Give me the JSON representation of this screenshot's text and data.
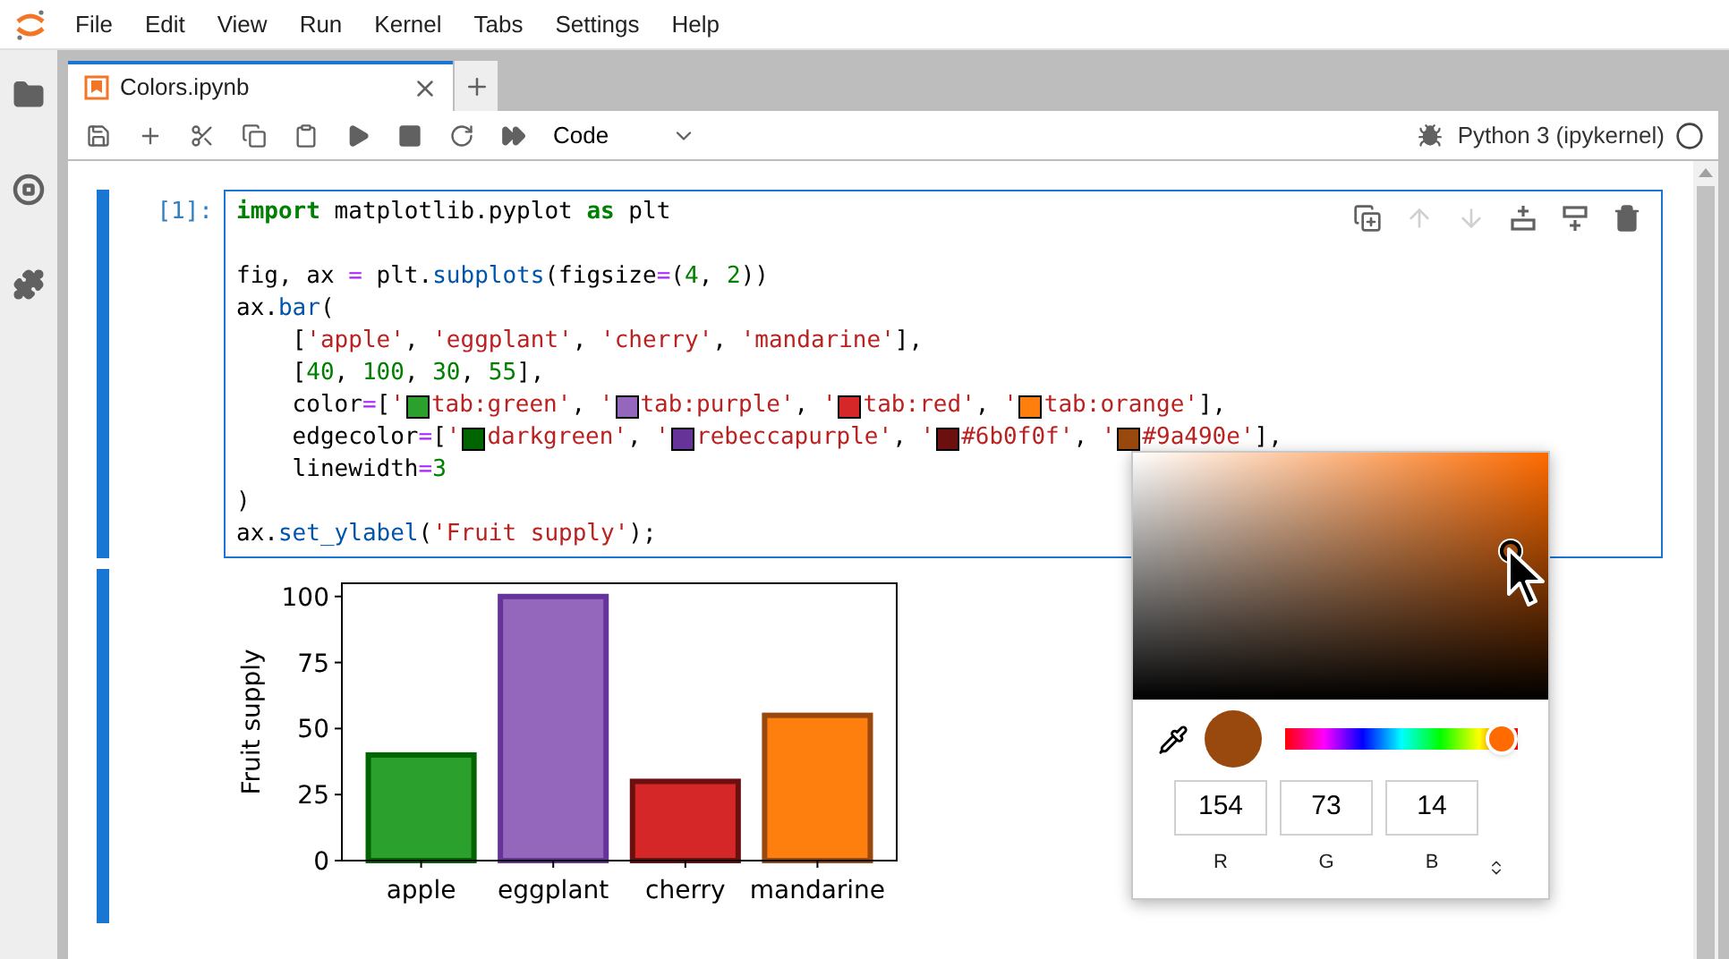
{
  "menu": [
    "File",
    "Edit",
    "View",
    "Run",
    "Kernel",
    "Tabs",
    "Settings",
    "Help"
  ],
  "tabs": [
    {
      "label": "Colors.ipynb",
      "selected": true
    }
  ],
  "toolbar": {
    "cell_type": "Code"
  },
  "kernel": {
    "name": "Python 3 (ipykernel)",
    "busy": false
  },
  "cell": {
    "prompt": "[1]:",
    "active": true,
    "lines": [
      {
        "kind": "code",
        "tokens": [
          {
            "kind": "kw",
            "text": "import"
          },
          {
            "kind": "plain",
            "text": " matplotlib.pyplot "
          },
          {
            "kind": "kw",
            "text": "as"
          },
          {
            "kind": "plain",
            "text": " plt"
          }
        ]
      },
      {
        "kind": "blank"
      },
      {
        "kind": "code",
        "tokens": [
          {
            "kind": "plain",
            "text": "fig, ax "
          },
          {
            "kind": "op",
            "text": "="
          },
          {
            "kind": "plain",
            "text": " plt."
          },
          {
            "kind": "fn",
            "text": "subplots"
          },
          {
            "kind": "plain",
            "text": "(figsize"
          },
          {
            "kind": "op",
            "text": "="
          },
          {
            "kind": "plain",
            "text": "("
          },
          {
            "kind": "num",
            "text": "4"
          },
          {
            "kind": "plain",
            "text": ", "
          },
          {
            "kind": "num",
            "text": "2"
          },
          {
            "kind": "plain",
            "text": "))"
          }
        ]
      },
      {
        "kind": "code",
        "tokens": [
          {
            "kind": "plain",
            "text": "ax."
          },
          {
            "kind": "fn",
            "text": "bar"
          },
          {
            "kind": "plain",
            "text": "("
          }
        ]
      },
      {
        "kind": "code",
        "tokens": [
          {
            "kind": "plain",
            "text": "    ["
          },
          {
            "kind": "str",
            "text": "'apple'"
          },
          {
            "kind": "plain",
            "text": ", "
          },
          {
            "kind": "str",
            "text": "'eggplant'"
          },
          {
            "kind": "plain",
            "text": ", "
          },
          {
            "kind": "str",
            "text": "'cherry'"
          },
          {
            "kind": "plain",
            "text": ", "
          },
          {
            "kind": "str",
            "text": "'mandarine'"
          },
          {
            "kind": "plain",
            "text": "],"
          }
        ]
      },
      {
        "kind": "code",
        "tokens": [
          {
            "kind": "plain",
            "text": "    ["
          },
          {
            "kind": "num",
            "text": "40"
          },
          {
            "kind": "plain",
            "text": ", "
          },
          {
            "kind": "num",
            "text": "100"
          },
          {
            "kind": "plain",
            "text": ", "
          },
          {
            "kind": "num",
            "text": "30"
          },
          {
            "kind": "plain",
            "text": ", "
          },
          {
            "kind": "num",
            "text": "55"
          },
          {
            "kind": "plain",
            "text": "],"
          }
        ]
      },
      {
        "kind": "code",
        "tokens": [
          {
            "kind": "plain",
            "text": "    color"
          },
          {
            "kind": "op",
            "text": "="
          },
          {
            "kind": "plain",
            "text": "["
          },
          {
            "kind": "str",
            "text": "'"
          },
          {
            "kind": "swatch",
            "color": "#2ca02c"
          },
          {
            "kind": "str",
            "text": "tab:green'"
          },
          {
            "kind": "plain",
            "text": ", "
          },
          {
            "kind": "str",
            "text": "'"
          },
          {
            "kind": "swatch",
            "color": "#9467bd"
          },
          {
            "kind": "str",
            "text": "tab:purple'"
          },
          {
            "kind": "plain",
            "text": ", "
          },
          {
            "kind": "str",
            "text": "'"
          },
          {
            "kind": "swatch",
            "color": "#d62728"
          },
          {
            "kind": "str",
            "text": "tab:red'"
          },
          {
            "kind": "plain",
            "text": ", "
          },
          {
            "kind": "str",
            "text": "'"
          },
          {
            "kind": "swatch",
            "color": "#ff7f0e"
          },
          {
            "kind": "str",
            "text": "tab:orange'"
          },
          {
            "kind": "plain",
            "text": "],"
          }
        ]
      },
      {
        "kind": "code",
        "tokens": [
          {
            "kind": "plain",
            "text": "    edgecolor"
          },
          {
            "kind": "op",
            "text": "="
          },
          {
            "kind": "plain",
            "text": "["
          },
          {
            "kind": "str",
            "text": "'"
          },
          {
            "kind": "swatch",
            "color": "#006400"
          },
          {
            "kind": "str",
            "text": "darkgreen'"
          },
          {
            "kind": "plain",
            "text": ", "
          },
          {
            "kind": "str",
            "text": "'"
          },
          {
            "kind": "swatch",
            "color": "#663399"
          },
          {
            "kind": "str",
            "text": "rebeccapurple'"
          },
          {
            "kind": "plain",
            "text": ", "
          },
          {
            "kind": "str",
            "text": "'"
          },
          {
            "kind": "swatch",
            "color": "#6b0f0f"
          },
          {
            "kind": "str",
            "text": "#6b0f0f'"
          },
          {
            "kind": "plain",
            "text": ", "
          },
          {
            "kind": "str",
            "text": "'"
          },
          {
            "kind": "swatch",
            "color": "#9a490e"
          },
          {
            "kind": "str",
            "text": "#9a490e'"
          },
          {
            "kind": "plain",
            "text": "],"
          }
        ]
      },
      {
        "kind": "code",
        "tokens": [
          {
            "kind": "plain",
            "text": "    linewidth"
          },
          {
            "kind": "op",
            "text": "="
          },
          {
            "kind": "num",
            "text": "3"
          }
        ]
      },
      {
        "kind": "code",
        "tokens": [
          {
            "kind": "plain",
            "text": ")"
          }
        ]
      },
      {
        "kind": "code",
        "tokens": [
          {
            "kind": "plain",
            "text": "ax."
          },
          {
            "kind": "fn",
            "text": "set_ylabel"
          },
          {
            "kind": "plain",
            "text": "("
          },
          {
            "kind": "str",
            "text": "'Fruit supply'"
          },
          {
            "kind": "plain",
            "text": ");"
          }
        ]
      }
    ]
  },
  "output": {
    "bar_edges": [
      {
        "color": "#006400"
      },
      {
        "color": "#663399"
      },
      {
        "color": "#6b0f0f"
      },
      {
        "color": "#9a490e"
      }
    ],
    "chart_data": {
      "type": "bar",
      "ylabel": "Fruit supply",
      "categories": [
        "apple",
        "eggplant",
        "cherry",
        "mandarine"
      ],
      "stacked": true,
      "series": [
        {
          "color": "#2ca02c",
          "values": [
            40,
            null,
            null,
            null
          ]
        },
        {
          "color": "#9467bd",
          "values": [
            null,
            100,
            null,
            null
          ]
        },
        {
          "color": "#d62728",
          "values": [
            null,
            null,
            30,
            null
          ]
        },
        {
          "color": "#ff7f0e",
          "values": [
            null,
            null,
            null,
            55
          ]
        }
      ],
      "ylim": [
        0,
        105
      ],
      "yticks": [
        0,
        25,
        50,
        75,
        100
      ]
    }
  },
  "color_picker": {
    "hue_slider": {
      "level": 0.93
    },
    "channels": [
      {
        "label": "R",
        "value": "154"
      },
      {
        "label": "G",
        "value": "73"
      },
      {
        "label": "B",
        "value": "14"
      }
    ]
  }
}
